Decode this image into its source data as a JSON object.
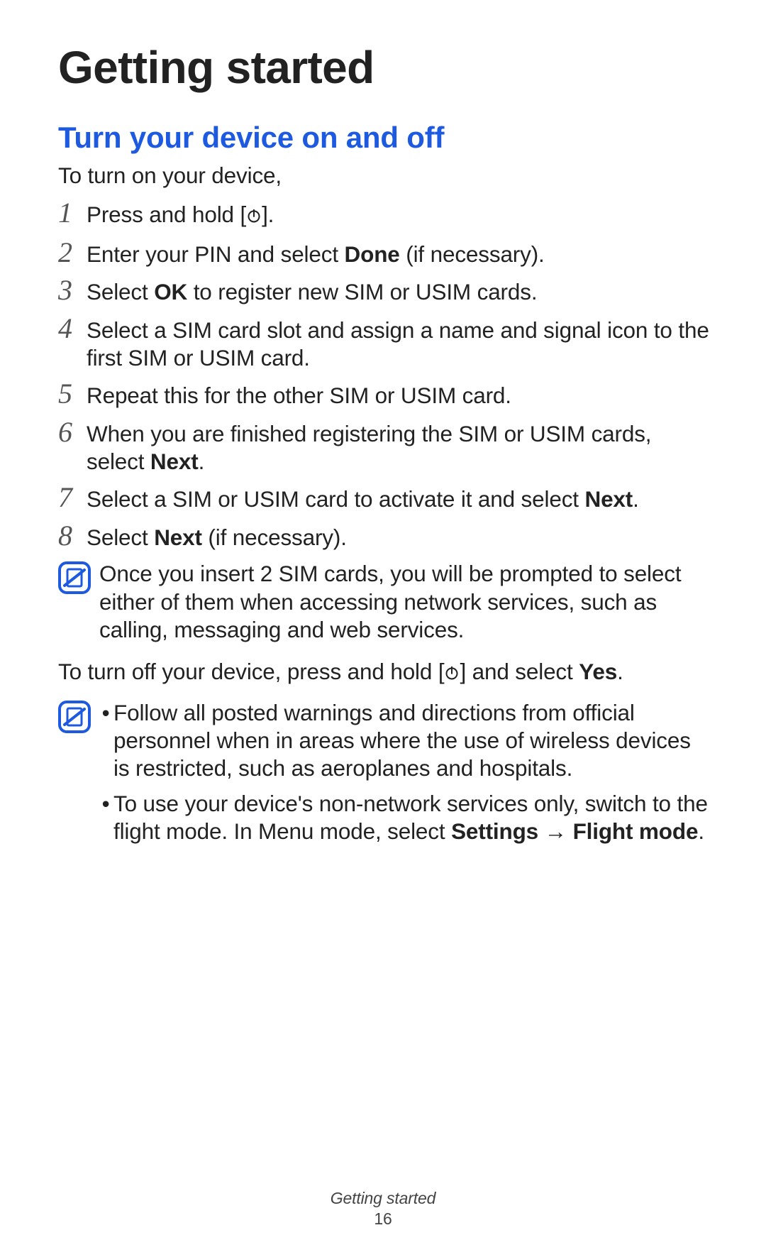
{
  "h1": "Getting started",
  "h2": "Turn your device on and off",
  "intro": "To turn on your device,",
  "steps": [
    {
      "n": "1",
      "prefix": "Press and hold [",
      "suffix": "]."
    },
    {
      "n": "2",
      "html": "Enter your PIN and select <b>Done</b> (if necessary)."
    },
    {
      "n": "3",
      "html": "Select <b>OK</b> to register new SIM or USIM cards."
    },
    {
      "n": "4",
      "html": "Select a SIM card slot and assign a name and signal icon to the first SIM or USIM card."
    },
    {
      "n": "5",
      "html": "Repeat this for the other SIM or USIM card."
    },
    {
      "n": "6",
      "html": "When you are finished registering the SIM or USIM cards, select <b>Next</b>."
    },
    {
      "n": "7",
      "html": "Select a SIM or USIM card to activate it and select <b>Next</b>."
    },
    {
      "n": "8",
      "html": "Select <b>Next</b> (if necessary)."
    }
  ],
  "note1": "Once you insert 2 SIM cards, you will be prompted to select either of them when accessing network services, such as calling, messaging and web services.",
  "turnoff_prefix": "To turn off your device, press and hold [",
  "turnoff_suffix_html": "] and select <b>Yes</b>.",
  "note2_bullets": [
    "Follow all posted warnings and directions from official personnel when in areas where the use of wireless devices is restricted, such as aeroplanes and hospitals.",
    "To use your device's non-network services only, switch to the flight mode. In Menu mode, select <b>Settings</b> → <b>Flight mode</b>."
  ],
  "footer_section": "Getting started",
  "footer_page": "16"
}
